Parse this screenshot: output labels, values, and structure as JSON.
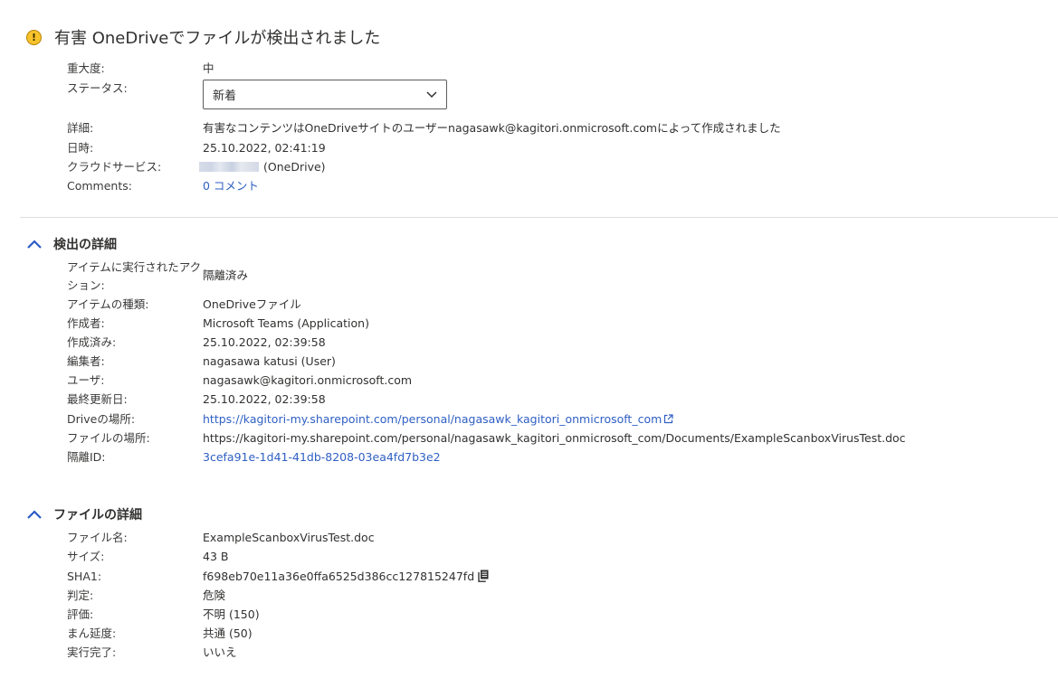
{
  "header": {
    "title": "有害 OneDriveでファイルが検出されました"
  },
  "alert": {
    "severity_label": "重大度:",
    "severity_value": "中",
    "status_label": "ステータス:",
    "status_value": "新着",
    "detail_label": "詳細:",
    "detail_value": "有害なコンテンツはOneDriveサイトのユーザーnagasawk@kagitori.onmicrosoft.comによって作成されました",
    "datetime_label": "日時:",
    "datetime_value": "25.10.2022, 02:41:19",
    "cloud_label": "クラウドサービス:",
    "cloud_value": "(OneDrive)",
    "comments_label": "Comments:",
    "comments_value": "0 コメント"
  },
  "detection": {
    "section_title": "検出の詳細",
    "rows": [
      {
        "label": "アイテムに実行されたアクション:",
        "value": "隔離済み"
      },
      {
        "label": "アイテムの種類:",
        "value": "OneDriveファイル"
      },
      {
        "label": "作成者:",
        "value": "Microsoft Teams (Application)"
      },
      {
        "label": "作成済み:",
        "value": "25.10.2022, 02:39:58"
      },
      {
        "label": "編集者:",
        "value": "nagasawa katusi (User)"
      },
      {
        "label": "ユーザ:",
        "value": "nagasawk@kagitori.onmicrosoft.com"
      },
      {
        "label": "最終更新日:",
        "value": "25.10.2022, 02:39:58"
      },
      {
        "label": "Driveの場所:",
        "value": "https://kagitori-my.sharepoint.com/personal/nagasawk_kagitori_onmicrosoft_com"
      },
      {
        "label": "ファイルの場所:",
        "value": "https://kagitori-my.sharepoint.com/personal/nagasawk_kagitori_onmicrosoft_com/Documents/ExampleScanboxVirusTest.doc"
      },
      {
        "label": "隔離ID:",
        "value": "3cefa91e-1d41-41db-8208-03ea4fd7b3e2"
      }
    ]
  },
  "file": {
    "section_title": "ファイルの詳細",
    "rows": [
      {
        "label": "ファイル名:",
        "value": "ExampleScanboxVirusTest.doc"
      },
      {
        "label": "サイズ:",
        "value": "43 B"
      },
      {
        "label": "SHA1:",
        "value": "f698eb70e11a36e0ffa6525d386cc127815247fd"
      },
      {
        "label": "判定:",
        "value": "危険"
      },
      {
        "label": "評価:",
        "value": "不明 (150)"
      },
      {
        "label": "まん延度:",
        "value": "共通 (50)"
      },
      {
        "label": "実行完了:",
        "value": "いいえ"
      }
    ]
  },
  "colors": {
    "link": "#2f5fc4",
    "accent_chevron": "#2b5bc7",
    "warning": "#f6c32b"
  },
  "icons": [
    "warning-icon",
    "chevron-down-icon",
    "chevron-up-icon",
    "external-link-icon",
    "copy-icon"
  ]
}
